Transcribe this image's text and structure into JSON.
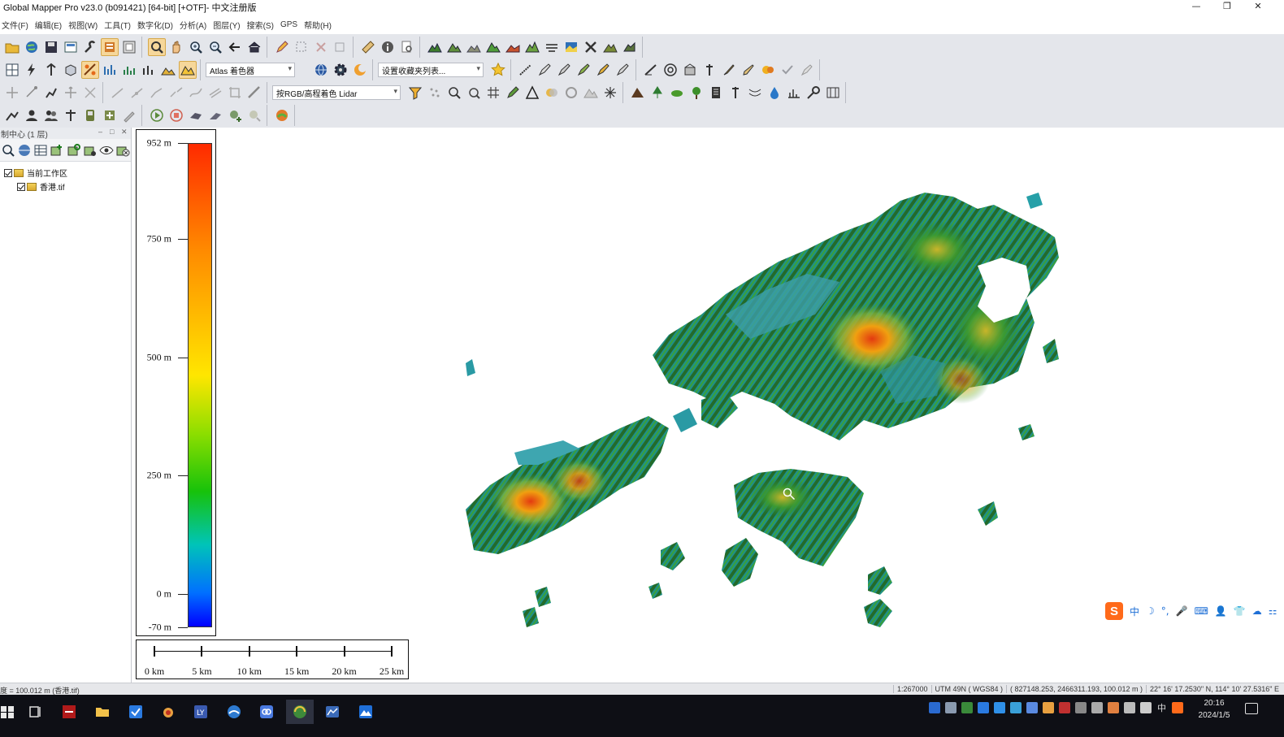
{
  "window": {
    "title": "Global Mapper Pro v23.0 (b091421) [64-bit] [+OTF]- 中文注册版",
    "controls": [
      "—",
      "❐",
      "✕"
    ]
  },
  "menu": [
    "文件(F)",
    "编辑(E)",
    "视图(W)",
    "工具(T)",
    "数字化(D)",
    "分析(A)",
    "图层(Y)",
    "搜索(S)",
    "GPS",
    "帮助(H)"
  ],
  "toolbar": {
    "shader_select": "Atlas 着色器",
    "favorites_select": "设置收藏夹列表...",
    "lidar_color_select": "按RGB/高程着色 Lidar"
  },
  "control_center": {
    "title": "制中心 (1 层)",
    "tree": [
      {
        "label": "当前工作区"
      },
      {
        "label": "香港.tif"
      }
    ]
  },
  "legend": {
    "labels": [
      "952 m",
      "750 m",
      "500 m",
      "250 m",
      "0 m",
      "-70 m"
    ],
    "values": [
      952,
      750,
      500,
      250,
      0,
      -70
    ],
    "min": -70,
    "max": 952,
    "colors": [
      "#ff2a00",
      "#ff8a00",
      "#ffe600",
      "#17c20a",
      "#00c4b8",
      "#0000ff"
    ]
  },
  "scale_bar": {
    "labels": [
      "0 km",
      "5 km",
      "10 km",
      "15 km",
      "20 km",
      "25 km"
    ],
    "values": [
      0,
      5,
      10,
      15,
      20,
      25
    ]
  },
  "statusbar": {
    "left": "度 = 100.012 m (香港.tif)",
    "scale": "1:267000",
    "projection": "UTM 49N ( WGS84 )",
    "coords": "( 827148.253, 2466311.193, 100.012 m )",
    "latlon": "22° 16' 17.2530\" N, 114° 10' 27.5316\" E"
  },
  "ime": {
    "items": [
      "中",
      "☽",
      "°,",
      "🎤",
      "⌨",
      "👤",
      "👕",
      "☁",
      "⚏"
    ]
  },
  "taskbar": {
    "time": "20:16",
    "date": "2024/1/5",
    "lang": "中"
  }
}
